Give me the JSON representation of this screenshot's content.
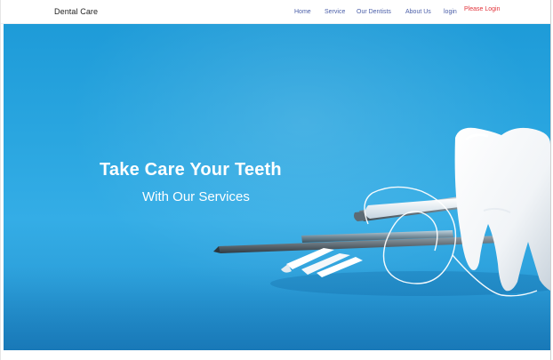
{
  "header": {
    "brand": "Dental Care",
    "nav": [
      {
        "label": "Home"
      },
      {
        "label": "Service"
      },
      {
        "label": "Our Dentists"
      },
      {
        "label": "About Us"
      },
      {
        "label": "login"
      }
    ],
    "login_prompt": "Please Login"
  },
  "hero": {
    "title": "Take Care Your Teeth",
    "subtitle": "With Our Services"
  },
  "colors": {
    "hero_blue": "#2aa6e0",
    "nav_link": "#4a5ea8",
    "login_prompt": "#e2333b"
  }
}
